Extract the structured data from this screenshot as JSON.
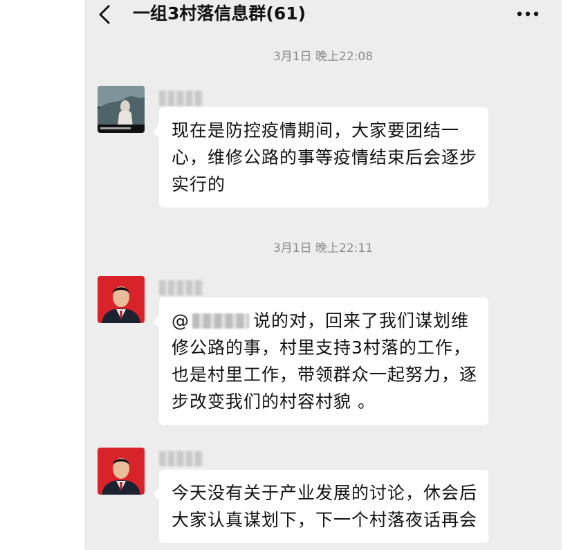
{
  "header": {
    "back_icon": "chevron-left-icon",
    "title": "一组3村落信息群(61)",
    "more_icon": "more-dots-icon"
  },
  "messages": [
    {
      "timestamp": "3月1日 晚上22:08",
      "avatar": "scenic-photo-avatar",
      "text": "现在是防控疫情期间，大家要团结一心，维修公路的事等疫情结束后会逐步实行的"
    },
    {
      "timestamp": "3月1日 晚上22:11",
      "avatar": "official-portrait-avatar",
      "mention_prefix": "@",
      "text": "说的对，回来了我们谋划维修公路的事，村里支持3村落的工作，也是村里工作，带领群众一起努力，逐步改变我们的村容村貌 。"
    },
    {
      "avatar": "official-portrait-avatar",
      "text": "今天没有关于产业发展的讨论，休会后大家认真谋划下，下一个村落夜话再会"
    }
  ],
  "colors": {
    "chat_background": "#ededed",
    "bubble": "#ffffff",
    "timestamp_text": "#8c8c8c",
    "title_text": "#111111"
  }
}
